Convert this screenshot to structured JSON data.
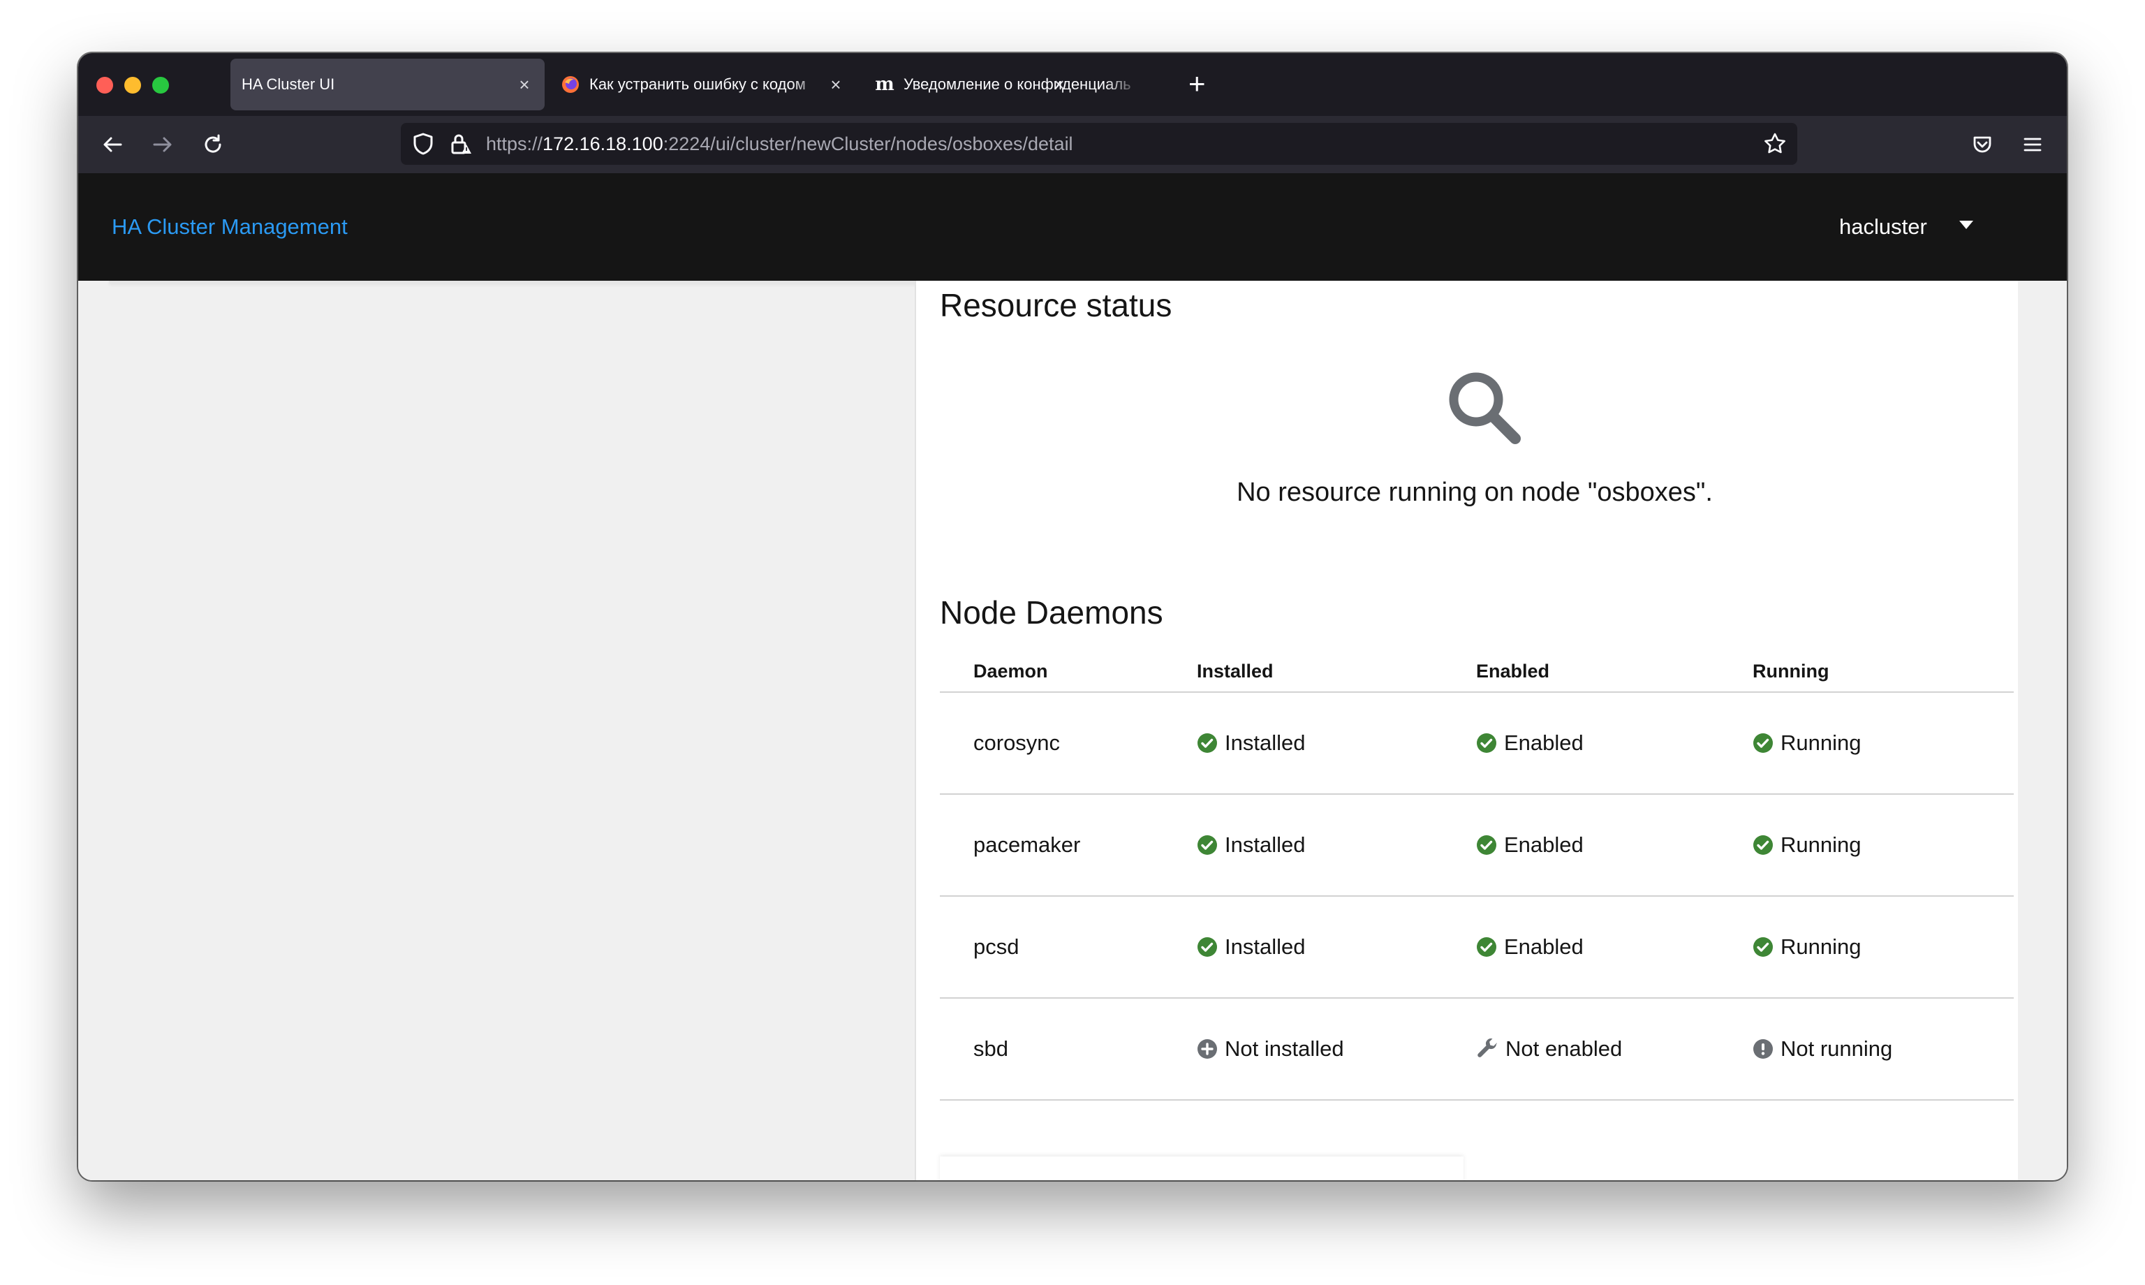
{
  "browser": {
    "tabs": [
      {
        "title": "HA Cluster UI",
        "active": true,
        "favicon": "none"
      },
      {
        "title": "Как устранить ошибку с кодом",
        "active": false,
        "favicon": "firefox-icon"
      },
      {
        "title": "Уведомление о конфиденциаль",
        "active": false,
        "favicon": "m-letter-icon"
      }
    ],
    "new_tab_label": "+",
    "url": {
      "scheme": "https://",
      "host": "172.16.18.100",
      "rest": ":2224/ui/cluster/newCluster/nodes/osboxes/detail"
    }
  },
  "app": {
    "brand": "HA Cluster Management",
    "user": "hacluster"
  },
  "resource_status": {
    "title": "Resource status",
    "empty_message": "No resource running on node \"osboxes\"."
  },
  "node_daemons": {
    "title": "Node Daemons",
    "columns": [
      "Daemon",
      "Installed",
      "Enabled",
      "Running"
    ],
    "rows": [
      {
        "daemon": "corosync",
        "installed": "Installed",
        "enabled": "Enabled",
        "running": "Running"
      },
      {
        "daemon": "pacemaker",
        "installed": "Installed",
        "enabled": "Enabled",
        "running": "Running"
      },
      {
        "daemon": "pcsd",
        "installed": "Installed",
        "enabled": "Enabled",
        "running": "Running"
      },
      {
        "daemon": "sbd",
        "installed": "Not installed",
        "enabled": "Not enabled",
        "running": "Not running"
      }
    ],
    "icons": {
      "ok": "check-circle-icon",
      "not_installed": "plus-circle-icon",
      "not_enabled": "wrench-icon",
      "not_running": "exclamation-circle-icon"
    }
  },
  "colors": {
    "brand_link": "#2b9af3",
    "success": "#3e8635",
    "muted_icon": "#6a6e73",
    "header_bg": "#151515"
  }
}
